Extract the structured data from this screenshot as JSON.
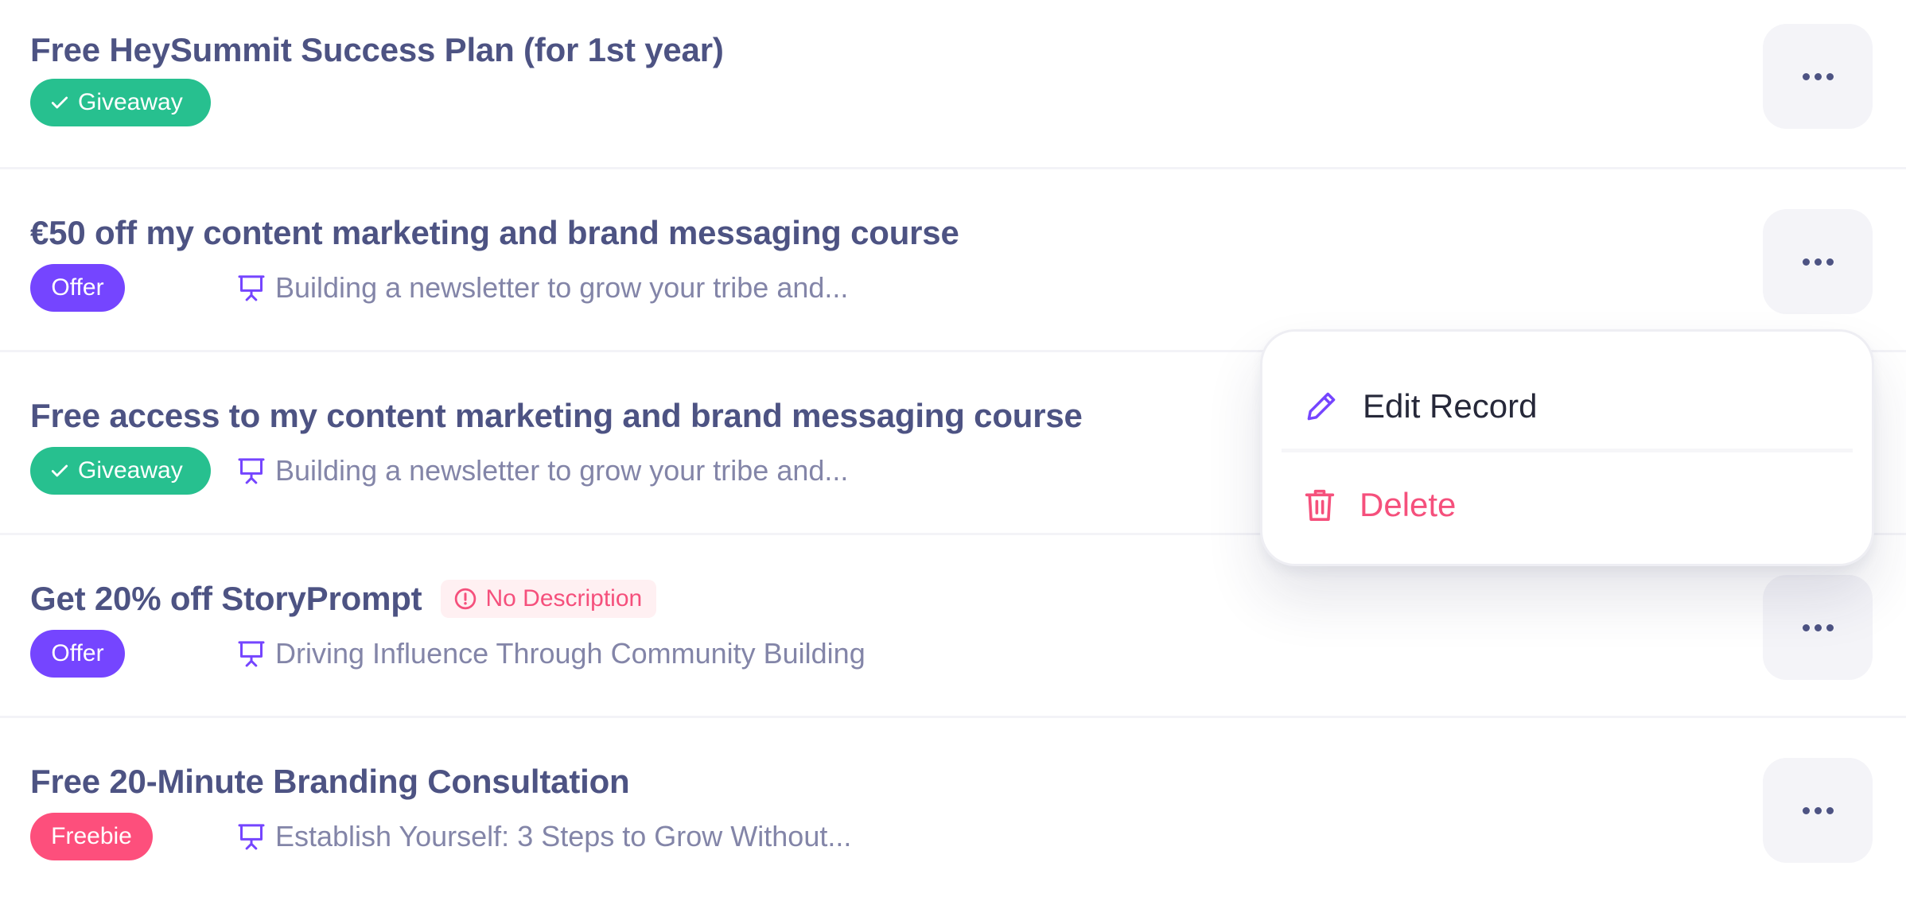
{
  "records": [
    {
      "title": "Free HeySummit Success Plan (for 1st year)",
      "type": "Giveaway",
      "type_icon": "check-icon",
      "session": null,
      "warning": null
    },
    {
      "title": "€50 off my content marketing and brand messaging course",
      "type": "Offer",
      "type_icon": null,
      "session": "Building a newsletter to grow your tribe and...",
      "warning": null
    },
    {
      "title": "Free access to my content marketing and brand messaging course",
      "type": "Giveaway",
      "type_icon": "check-icon",
      "session": "Building a newsletter to grow your tribe and...",
      "warning": null
    },
    {
      "title": "Get 20% off StoryPrompt",
      "type": "Offer",
      "type_icon": null,
      "session": "Driving Influence Through Community Building",
      "warning": "No Description"
    },
    {
      "title": "Free 20-Minute Branding Consultation",
      "type": "Freebie",
      "type_icon": null,
      "session": "Establish Yourself: 3 Steps to Grow Without...",
      "warning": null
    }
  ],
  "more_button_icon": "more-horizontal-icon",
  "session_icon": "presentation-icon",
  "context_menu": {
    "open_for_record": 2,
    "items": [
      {
        "label": "Edit Record",
        "icon": "pencil-icon"
      },
      {
        "label": "Delete",
        "icon": "trash-icon"
      }
    ]
  },
  "colors": {
    "title": "#4d5383",
    "session_text": "#8385a8",
    "giveaway": "#27c08f",
    "offer": "#7545ff",
    "freebie": "#fd4f7c",
    "warning_text": "#f5507c",
    "warning_bg": "#fff0f2",
    "icon_accent": "#7545ff",
    "delete": "#f5507c"
  }
}
